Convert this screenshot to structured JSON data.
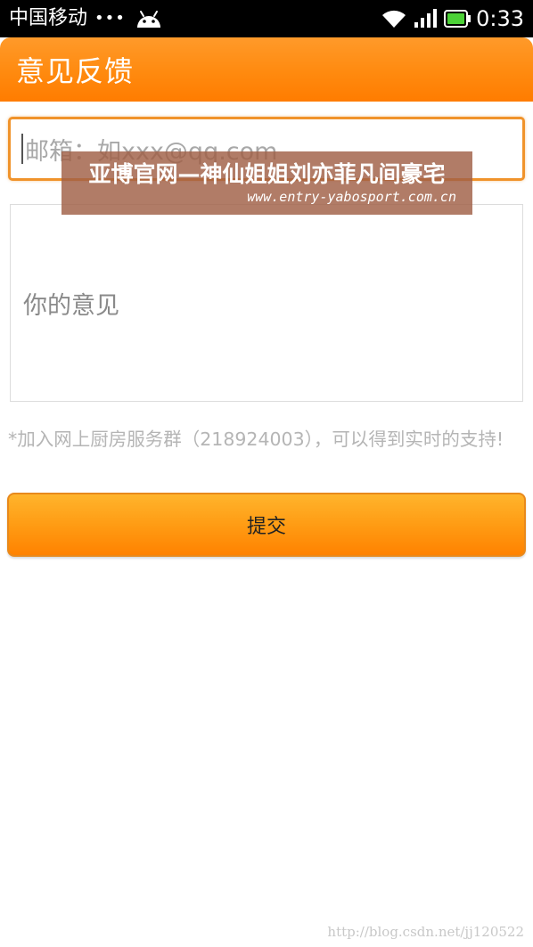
{
  "status_bar": {
    "carrier": "中国移动",
    "dots": "•••",
    "time": "0:33",
    "icons": [
      "android-icon",
      "wifi-icon",
      "signal-icon",
      "battery-icon"
    ]
  },
  "header": {
    "title": "意见反馈"
  },
  "form": {
    "email_placeholder": "邮箱：如xxx@qq.com",
    "feedback_placeholder": "你的意见",
    "hint": "*加入网上厨房服务群（218924003），可以得到实时的支持!",
    "submit_label": "提交"
  },
  "banner": {
    "title": "亚博官网—神仙姐姐刘亦菲凡间豪宅",
    "url": "www.entry-yabosport.com.cn"
  },
  "watermark": "http://blog.csdn.net/jj120522",
  "colors": {
    "accent": "#ff8a0f",
    "input_border": "#f0932b",
    "status_bar": "#000000",
    "battery_green": "#4cd137"
  }
}
